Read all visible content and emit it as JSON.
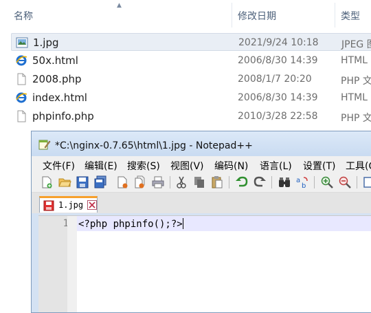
{
  "explorer": {
    "columns": {
      "name": "名称",
      "date": "修改日期",
      "type": "类型"
    },
    "files": [
      {
        "name": "1.jpg",
        "date": "2021/9/24 10:18",
        "type": "JPEG 图",
        "icon": "image-file-icon"
      },
      {
        "name": "50x.html",
        "date": "2006/8/30 14:39",
        "type": "HTML",
        "icon": "ie-file-icon"
      },
      {
        "name": "2008.php",
        "date": "2008/1/7 20:20",
        "type": "PHP 文",
        "icon": "blank-file-icon"
      },
      {
        "name": "index.html",
        "date": "2006/8/30 14:39",
        "type": "HTML",
        "icon": "ie-file-icon"
      },
      {
        "name": "phpinfo.php",
        "date": "2010/3/28 22:58",
        "type": "PHP 文",
        "icon": "blank-file-icon"
      }
    ]
  },
  "notepad": {
    "title": "*C:\\nginx-0.7.65\\html\\1.jpg - Notepad++",
    "menu": {
      "file": "文件(F)",
      "edit": "编辑(E)",
      "search": "搜索(S)",
      "view": "视图(V)",
      "encoding": "编码(N)",
      "language": "语言(L)",
      "settings": "设置(T)",
      "tools": "工具(O)"
    },
    "tab": {
      "label": "1.jpg"
    },
    "editor": {
      "line_number": "1",
      "code": "<?php phpinfo();?>"
    },
    "colors": {
      "tab_accent": "#f7a02c",
      "current_line": "#e8e8ff"
    }
  }
}
